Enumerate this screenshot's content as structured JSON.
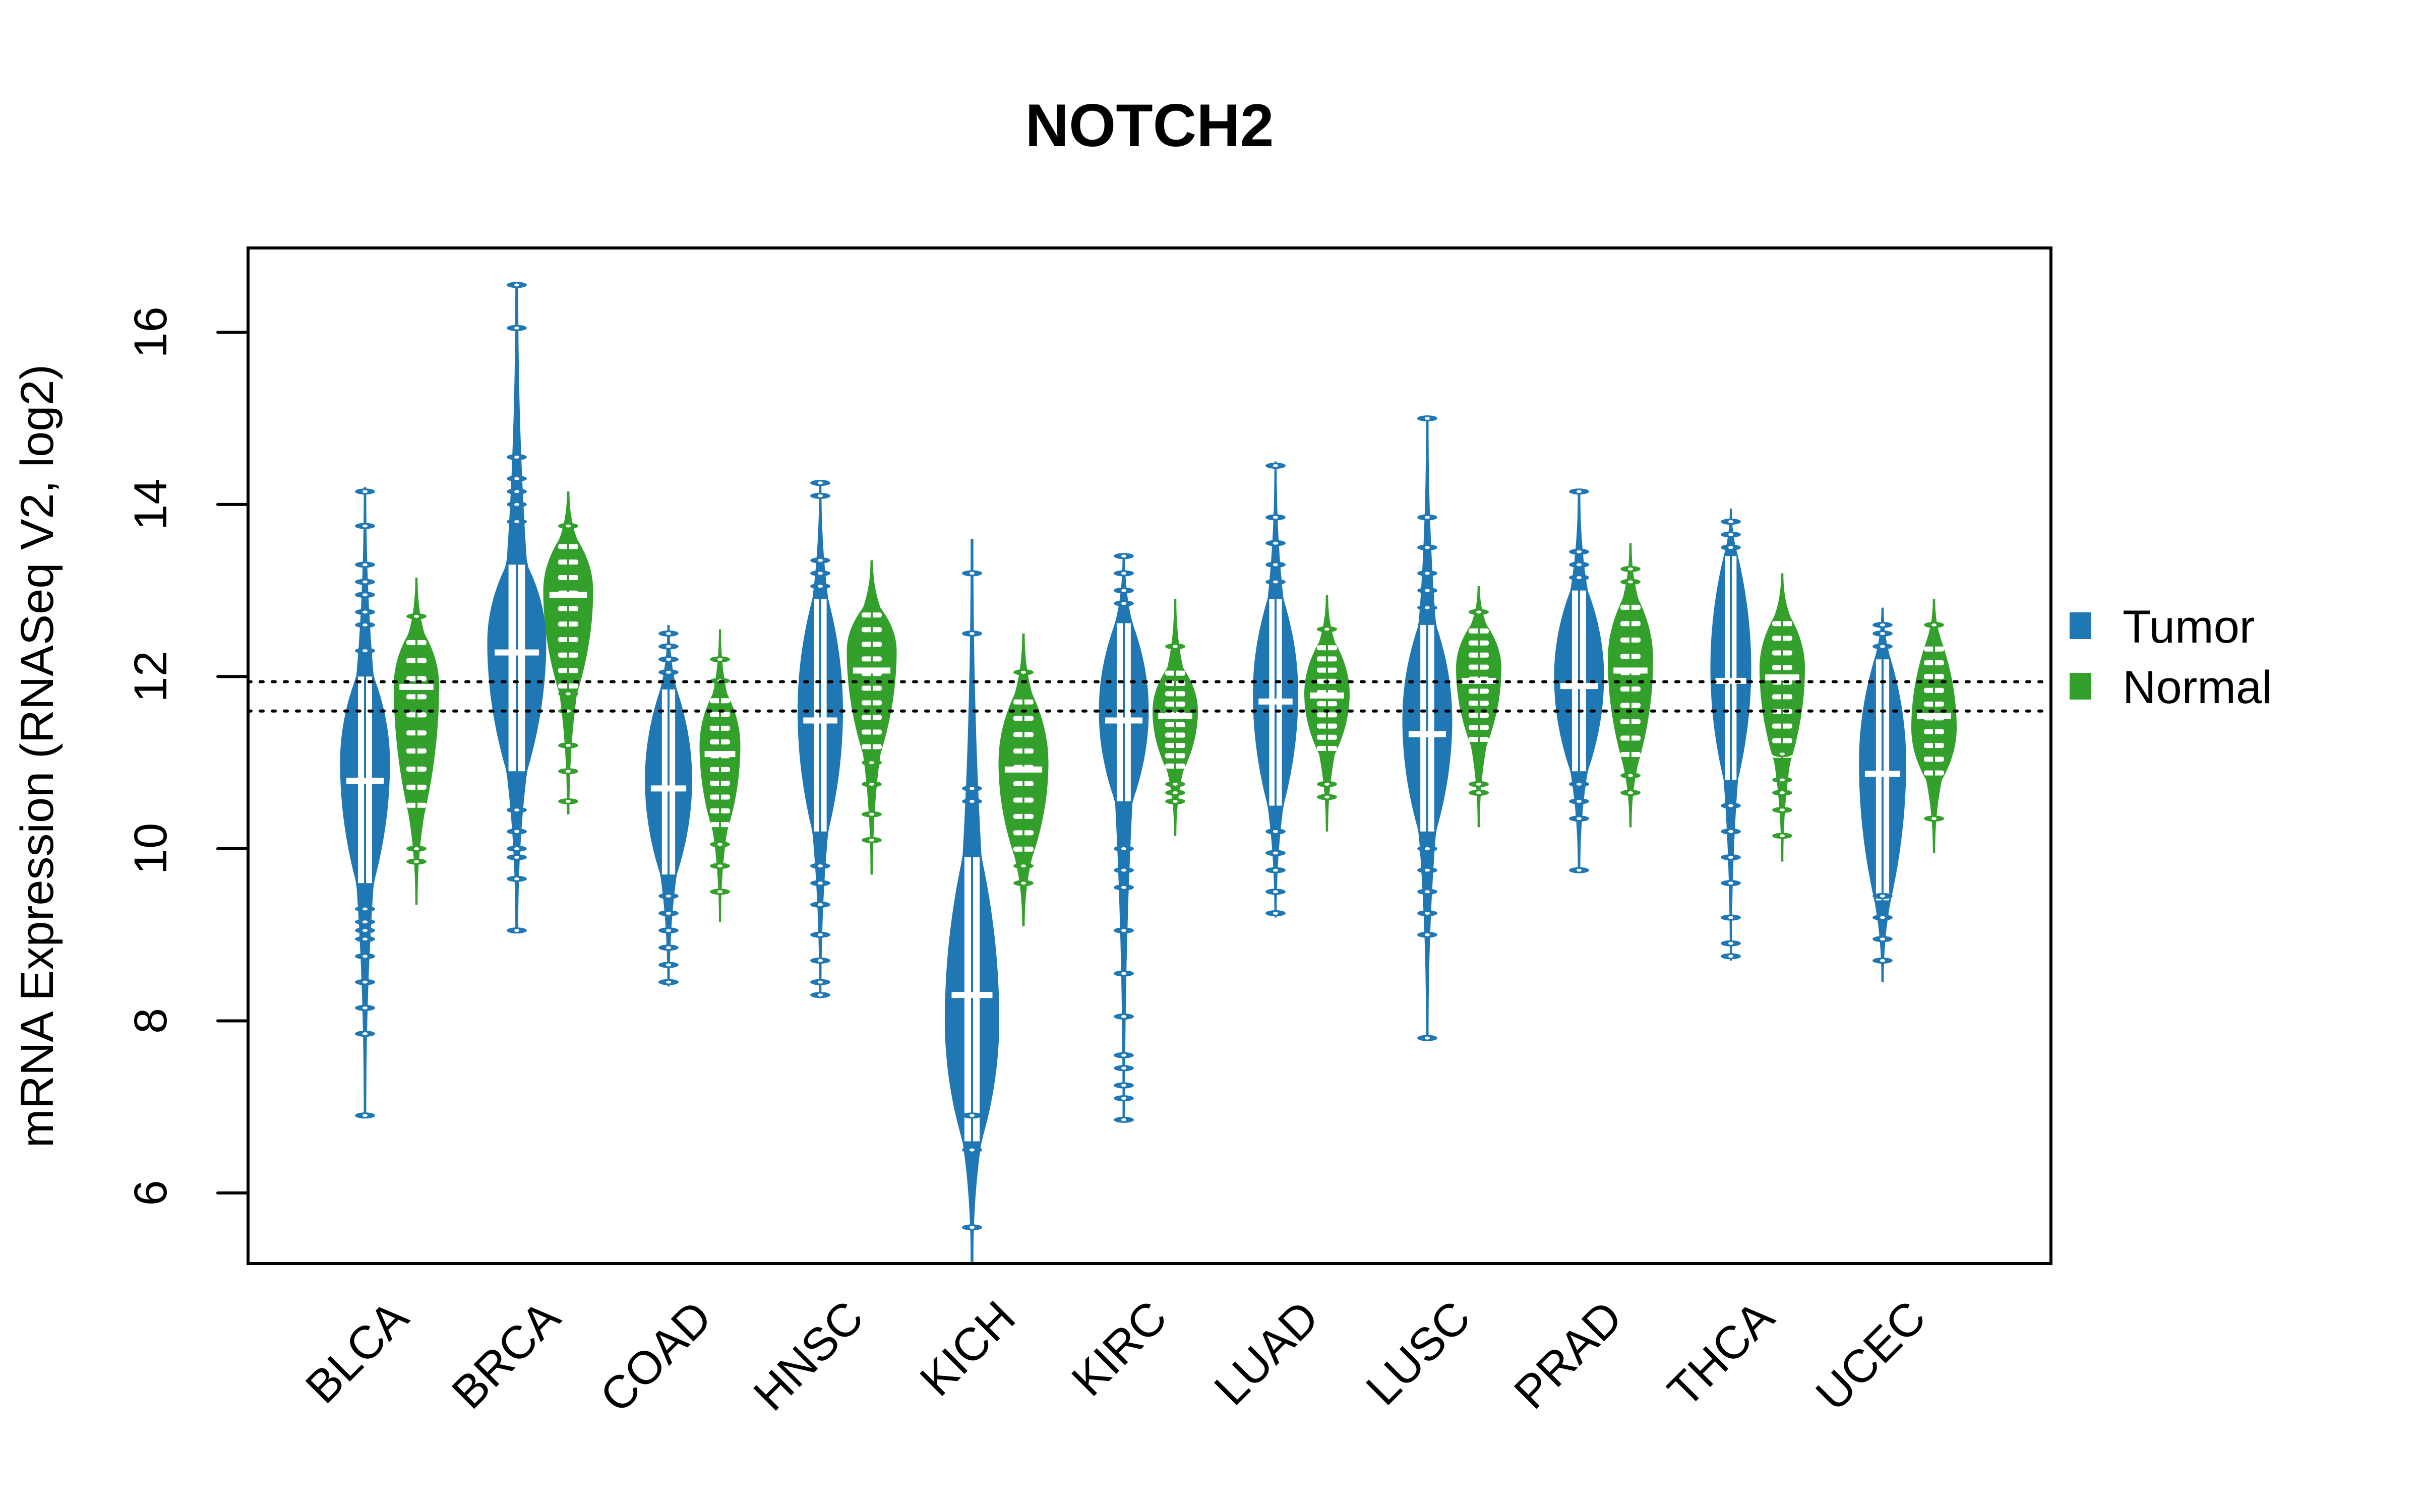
{
  "chart_data": {
    "type": "violin",
    "title": "NOTCH2",
    "xlabel": "",
    "ylabel": "mRNA Expression (RNASeq V2, log2)",
    "ylim": [
      5.18,
      16.98
    ],
    "yticks": [
      6,
      8,
      10,
      12,
      14,
      16
    ],
    "grid": false,
    "legend": {
      "position": "right",
      "entries": [
        {
          "name": "Tumor",
          "color": "#1F77B4"
        },
        {
          "name": "Normal",
          "color": "#33A02C"
        }
      ]
    },
    "reference_lines": [
      {
        "y": 11.94,
        "style": "dotted"
      },
      {
        "y": 11.6,
        "style": "dotted"
      }
    ],
    "categories": [
      "BLCA",
      "BRCA",
      "COAD",
      "HNSC",
      "KICH",
      "KIRC",
      "LUAD",
      "LUSC",
      "PRAD",
      "THCA",
      "UCEC"
    ],
    "series": [
      {
        "name": "Tumor",
        "color": "#1F77B4",
        "groups": [
          {
            "min": 6.9,
            "body_low": 9.6,
            "median": 10.79,
            "mode": 11.0,
            "body_high": 12.0,
            "max": 14.2,
            "width": 0.55,
            "outliers": [
              6.9,
              7.85,
              8.15,
              8.45,
              8.75,
              8.95,
              9.05,
              9.15,
              9.3,
              12.3,
              12.6,
              12.75,
              12.95,
              13.1,
              13.3,
              13.75,
              14.15
            ]
          },
          {
            "min": 9.05,
            "body_low": 10.9,
            "median": 12.28,
            "mode": 12.4,
            "body_high": 13.3,
            "max": 16.55,
            "width": 0.65,
            "outliers": [
              9.05,
              9.65,
              9.9,
              10.0,
              10.2,
              10.45,
              13.8,
              14.0,
              14.15,
              14.3,
              14.55,
              16.05,
              16.55
            ]
          },
          {
            "min": 8.4,
            "body_low": 9.7,
            "median": 10.7,
            "mode": 10.8,
            "body_high": 11.85,
            "max": 12.6,
            "width": 0.52,
            "outliers": [
              8.45,
              8.65,
              8.85,
              9.05,
              9.25,
              9.45,
              12.05,
              12.2,
              12.35,
              12.5
            ]
          },
          {
            "min": 8.3,
            "body_low": 10.2,
            "median": 11.49,
            "mode": 11.6,
            "body_high": 12.9,
            "max": 14.25,
            "width": 0.5,
            "outliers": [
              8.3,
              8.45,
              8.7,
              9.0,
              9.35,
              9.6,
              9.8,
              13.05,
              13.2,
              13.35,
              14.1,
              14.25
            ]
          },
          {
            "min": 5.2,
            "body_low": 6.6,
            "median": 8.3,
            "mode": 8.0,
            "body_high": 9.9,
            "max": 13.6,
            "width": 0.6,
            "outliers": [
              5.6,
              6.5,
              6.9,
              10.55,
              10.7,
              12.5,
              13.2
            ]
          },
          {
            "min": 6.85,
            "body_low": 10.55,
            "median": 11.49,
            "mode": 11.6,
            "body_high": 12.62,
            "max": 13.4,
            "width": 0.55,
            "outliers": [
              6.85,
              7.1,
              7.25,
              7.45,
              7.6,
              8.05,
              8.55,
              9.05,
              9.55,
              9.75,
              10.0,
              12.85,
              13.0,
              13.2,
              13.4
            ]
          },
          {
            "min": 9.2,
            "body_low": 10.5,
            "median": 11.71,
            "mode": 11.8,
            "body_high": 12.9,
            "max": 14.5,
            "width": 0.5,
            "outliers": [
              9.25,
              9.5,
              9.75,
              9.95,
              10.2,
              13.1,
              13.3,
              13.55,
              13.85,
              14.45
            ]
          },
          {
            "min": 7.8,
            "body_low": 10.2,
            "median": 11.33,
            "mode": 11.5,
            "body_high": 12.6,
            "max": 15.0,
            "width": 0.55,
            "outliers": [
              7.8,
              9.0,
              9.25,
              9.5,
              9.75,
              10.0,
              12.8,
              13.0,
              13.2,
              13.5,
              13.85,
              15.0
            ]
          },
          {
            "min": 9.75,
            "body_low": 10.9,
            "median": 11.89,
            "mode": 12.0,
            "body_high": 13.0,
            "max": 14.15,
            "width": 0.55,
            "outliers": [
              9.75,
              10.35,
              10.55,
              10.75,
              13.15,
              13.3,
              13.45,
              14.15
            ]
          },
          {
            "min": 8.7,
            "body_low": 10.8,
            "median": 11.95,
            "mode": 12.1,
            "body_high": 13.4,
            "max": 13.95,
            "width": 0.45,
            "outliers": [
              8.75,
              8.9,
              9.2,
              9.6,
              9.9,
              10.2,
              10.5,
              13.5,
              13.65,
              13.8
            ]
          },
          {
            "min": 8.45,
            "body_low": 9.4,
            "median": 10.87,
            "mode": 11.0,
            "body_high": 12.2,
            "max": 12.8,
            "width": 0.52,
            "outliers": [
              8.7,
              8.95,
              9.2,
              9.45,
              12.35,
              12.5,
              12.6
            ]
          }
        ]
      },
      {
        "name": "Normal",
        "color": "#33A02C",
        "groups": [
          {
            "min": 9.35,
            "body_low": 10.4,
            "median": 11.88,
            "mode": 11.9,
            "body_high": 12.5,
            "max": 13.15,
            "width": 0.5,
            "outliers": [
              9.85,
              10.0,
              12.7
            ]
          },
          {
            "min": 10.4,
            "body_low": 11.8,
            "median": 12.95,
            "mode": 13.0,
            "body_high": 13.6,
            "max": 14.15,
            "width": 0.55,
            "outliers": [
              10.55,
              10.9,
              11.2,
              11.6,
              11.8,
              13.75
            ]
          },
          {
            "min": 9.15,
            "body_low": 10.2,
            "median": 11.1,
            "mode": 11.2,
            "body_high": 11.8,
            "max": 12.55,
            "width": 0.45,
            "outliers": [
              9.5,
              9.8,
              10.05,
              11.95,
              12.2
            ]
          },
          {
            "min": 9.7,
            "body_low": 11.1,
            "median": 12.07,
            "mode": 12.3,
            "body_high": 12.8,
            "max": 13.35,
            "width": 0.55,
            "outliers": [
              10.1,
              10.4,
              10.75,
              11.0
            ]
          },
          {
            "min": 9.1,
            "body_low": 9.9,
            "median": 10.92,
            "mode": 11.0,
            "body_high": 11.8,
            "max": 12.5,
            "width": 0.55,
            "outliers": [
              9.6,
              9.8,
              12.05
            ]
          },
          {
            "min": 10.15,
            "body_low": 10.9,
            "median": 11.54,
            "mode": 11.6,
            "body_high": 12.1,
            "max": 12.9,
            "width": 0.5,
            "outliers": [
              10.55,
              10.65,
              10.75,
              12.35
            ]
          },
          {
            "min": 10.2,
            "body_low": 11.1,
            "median": 11.78,
            "mode": 11.8,
            "body_high": 12.4,
            "max": 12.95,
            "width": 0.5,
            "outliers": [
              10.6,
              10.75,
              12.55
            ]
          },
          {
            "min": 10.25,
            "body_low": 11.2,
            "median": 11.95,
            "mode": 12.1,
            "body_high": 12.6,
            "max": 13.05,
            "width": 0.5,
            "outliers": [
              10.65,
              10.75,
              12.75
            ]
          },
          {
            "min": 10.25,
            "body_low": 11.0,
            "median": 12.07,
            "mode": 12.2,
            "body_high": 12.9,
            "max": 13.55,
            "width": 0.5,
            "outliers": [
              10.65,
              10.85,
              13.1,
              13.25
            ]
          },
          {
            "min": 9.85,
            "body_low": 11.0,
            "median": 11.99,
            "mode": 12.1,
            "body_high": 12.7,
            "max": 13.2,
            "width": 0.5,
            "outliers": [
              10.15,
              10.45,
              10.65,
              10.8,
              11.1
            ]
          },
          {
            "min": 9.95,
            "body_low": 10.8,
            "median": 11.54,
            "mode": 11.4,
            "body_high": 12.4,
            "max": 12.9,
            "width": 0.5,
            "outliers": [
              10.35,
              12.6
            ]
          }
        ]
      }
    ]
  }
}
